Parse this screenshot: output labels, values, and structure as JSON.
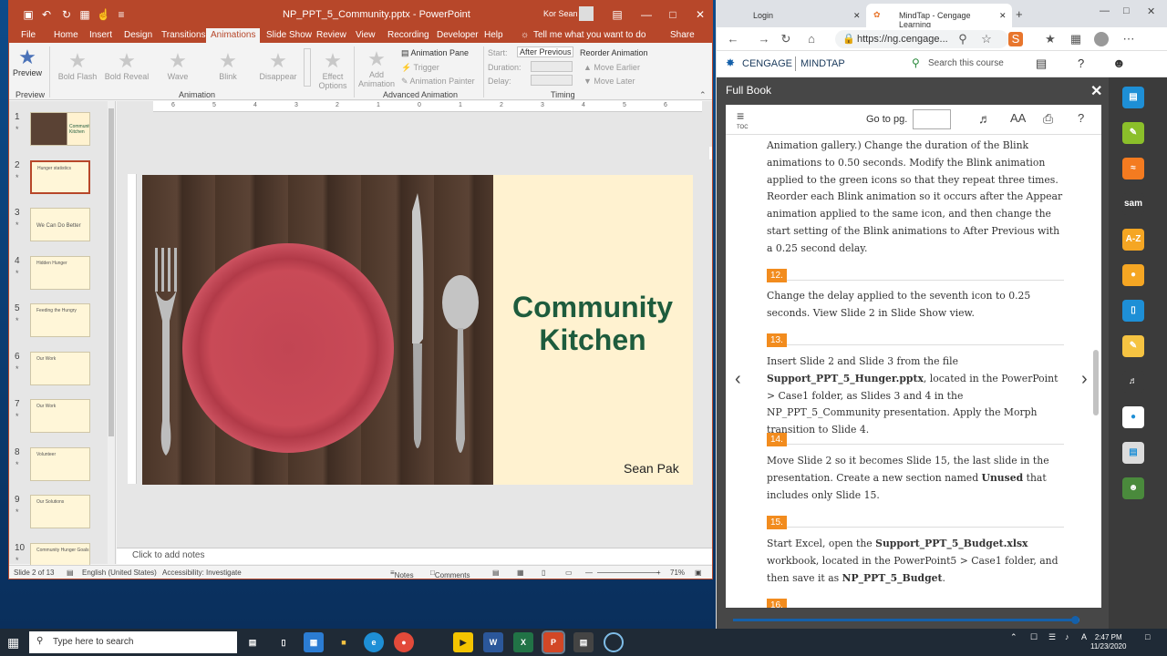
{
  "ppt": {
    "window_title": "NP_PPT_5_Community.pptx - PowerPoint",
    "user": "Kor Sean",
    "tabs": [
      "File",
      "Home",
      "Insert",
      "Design",
      "Transitions",
      "Animations",
      "Slide Show",
      "Review",
      "View",
      "Recording",
      "Developer",
      "Help"
    ],
    "active_tab": "Animations",
    "tell_me": "Tell me what you want to do",
    "share": "Share",
    "ribbon": {
      "preview": "Preview",
      "preview_group": "Preview",
      "animations": [
        "Bold Flash",
        "Bold Reveal",
        "Wave",
        "Blink",
        "Disappear"
      ],
      "effect_options": "Effect Options",
      "animation_group": "Animation",
      "add_animation": "Add Animation",
      "animation_pane": "Animation Pane",
      "trigger": "Trigger",
      "animation_painter": "Animation Painter",
      "advanced_group": "Advanced Animation",
      "start_label": "Start:",
      "start_value": "After Previous",
      "duration_label": "Duration:",
      "delay_label": "Delay:",
      "reorder": "Reorder Animation",
      "move_earlier": "Move Earlier",
      "move_later": "Move Later",
      "timing_group": "Timing"
    },
    "thumbnails": [
      {
        "num": "1",
        "text": "Community Kitchen"
      },
      {
        "num": "2",
        "text": "Hunger statistics"
      },
      {
        "num": "3",
        "text": "We Can Do Better"
      },
      {
        "num": "4",
        "text": "Hidden Hunger"
      },
      {
        "num": "5",
        "text": "Feeding the Hungry"
      },
      {
        "num": "6",
        "text": "Our Work"
      },
      {
        "num": "7",
        "text": "Our Work"
      },
      {
        "num": "8",
        "text": "Volunteer"
      },
      {
        "num": "9",
        "text": "Our Solutions"
      },
      {
        "num": "10",
        "text": "Community Hunger Goals"
      }
    ],
    "ruler_ticks": [
      "6",
      "5",
      "4",
      "3",
      "2",
      "1",
      "0",
      "1",
      "2",
      "3",
      "4",
      "5",
      "6"
    ],
    "slide": {
      "title_line1": "Community",
      "title_line2": "Kitchen",
      "author": "Sean Pak"
    },
    "notes_placeholder": "Click to add notes",
    "status": {
      "slide": "Slide 2 of 13",
      "language": "English (United States)",
      "accessibility": "Accessibility: Investigate",
      "notes": "Notes",
      "comments": "Comments",
      "zoom": "71%"
    }
  },
  "browser": {
    "tabs": [
      {
        "label": "Login"
      },
      {
        "label": "MindTap - Cengage Learning"
      }
    ],
    "url": "https://ng.cengage...",
    "brand": "CENGAGE",
    "product": "MINDTAP",
    "search_placeholder": "Search this course",
    "panel_title": "Full Book",
    "toc": "TOC",
    "goto_label": "Go to pg.",
    "font_size_label": "AA",
    "book": {
      "intro": "Animation gallery.) Change the duration of the Blink animations to 0.50 seconds. Modify the Blink animation applied to the green icons so that they repeat three times. Reorder each Blink animation so it occurs after the Appear animation applied to the same icon, and then change the start setting of the Blink animations to After Previous with a 0.25 second delay.",
      "steps": [
        {
          "num": "12.",
          "text": "Change the delay applied to the seventh icon to 0.25 seconds. View Slide 2 in Slide Show view."
        },
        {
          "num": "13.",
          "text_a": "Insert Slide 2 and Slide 3 from the file ",
          "bold_a": "Support_PPT_5_Hunger.pptx",
          "text_b": ", located in the PowerPoint > Case1 folder, as Slides 3 and 4 in the NP_PPT_5_Community presentation. Apply the Morph transition to Slide 4."
        },
        {
          "num": "14.",
          "text_a": "Move Slide 2 so it becomes Slide 15, the last slide in the presentation. Create a new section named ",
          "bold_a": "Unused",
          "text_b": " that includes only Slide 15."
        },
        {
          "num": "15.",
          "text_a": "Start Excel, open the ",
          "bold_a": "Support_PPT_5_Budget.xlsx",
          "text_b": " workbook, located in the PowerPoint5 > Case1 folder, and then save it as ",
          "bold_b": "NP_PPT_5_Budget",
          "text_c": "."
        },
        {
          "num": "16.",
          "text": ""
        }
      ]
    },
    "progress_value": 0.99
  },
  "rail": [
    "toolbox",
    "pencil",
    "rss",
    "sam",
    "A-Z",
    "cengage",
    "book",
    "notes",
    "ear",
    "cnow",
    "paper",
    "avatar"
  ],
  "taskbar": {
    "search_placeholder": "Type here to search",
    "time": "2:47 PM",
    "date": "11/23/2020"
  }
}
